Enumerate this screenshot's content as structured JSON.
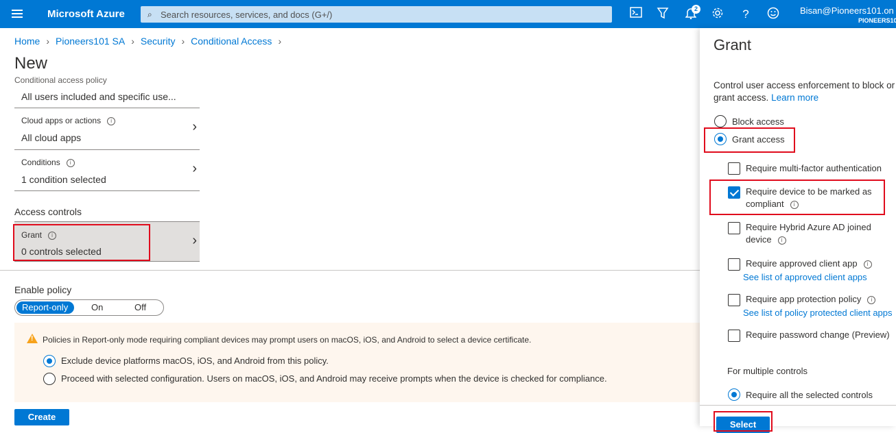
{
  "topbar": {
    "brand": "Microsoft Azure",
    "search_placeholder": "Search resources, services, and docs (G+/)",
    "notifications_count": "2",
    "user_name": "Bisan@Pioneers101.on",
    "user_org": "PIONEERS10",
    "icons": [
      "menu-icon",
      "cloud-shell-icon",
      "directory-filter-icon",
      "bell-icon",
      "gear-icon",
      "help-icon",
      "feedback-icon"
    ]
  },
  "breadcrumb": [
    "Home",
    "Pioneers101 SA",
    "Security",
    "Conditional Access"
  ],
  "page": {
    "title": "New",
    "subtitle": "Conditional access policy"
  },
  "assignments": {
    "users_value": "All users included and specific use...",
    "cloud_apps_label": "Cloud apps or actions",
    "cloud_apps_value": "All cloud apps",
    "conditions_label": "Conditions",
    "conditions_value": "1 condition selected"
  },
  "access_controls": {
    "title": "Access controls",
    "grant_label": "Grant",
    "grant_value": "0 controls selected"
  },
  "enable_policy": {
    "label": "Enable policy",
    "options": [
      "Report-only",
      "On",
      "Off"
    ],
    "selected": "Report-only"
  },
  "warning": {
    "message": "Policies in Report-only mode requiring compliant devices may prompt users on macOS, iOS, and Android to select a device certificate.",
    "option1": "Exclude device platforms macOS, iOS, and Android from this policy.",
    "option2": "Proceed with selected configuration. Users on macOS, iOS, and Android may receive prompts when the device is checked for compliance.",
    "selected_option": 1
  },
  "create_label": "Create",
  "grant_panel": {
    "title": "Grant",
    "description": "Control user access enforcement to block or grant access.",
    "learn_more": "Learn more",
    "block_label": "Block access",
    "grant_label": "Grant access",
    "selected": "Grant access",
    "controls": [
      {
        "label": "Require multi-factor authentication",
        "checked": false
      },
      {
        "label": "Require device to be marked as compliant",
        "checked": true
      },
      {
        "label": "Require Hybrid Azure AD joined device",
        "checked": false
      },
      {
        "label": "Require approved client app",
        "checked": false,
        "link": "See list of approved client apps"
      },
      {
        "label": "Require app protection policy",
        "checked": false,
        "link": "See list of policy protected client apps"
      },
      {
        "label": "Require password change (Preview)",
        "checked": false
      }
    ],
    "multiple_label": "For multiple controls",
    "multiple_option": "Require all the selected controls",
    "select_label": "Select"
  }
}
